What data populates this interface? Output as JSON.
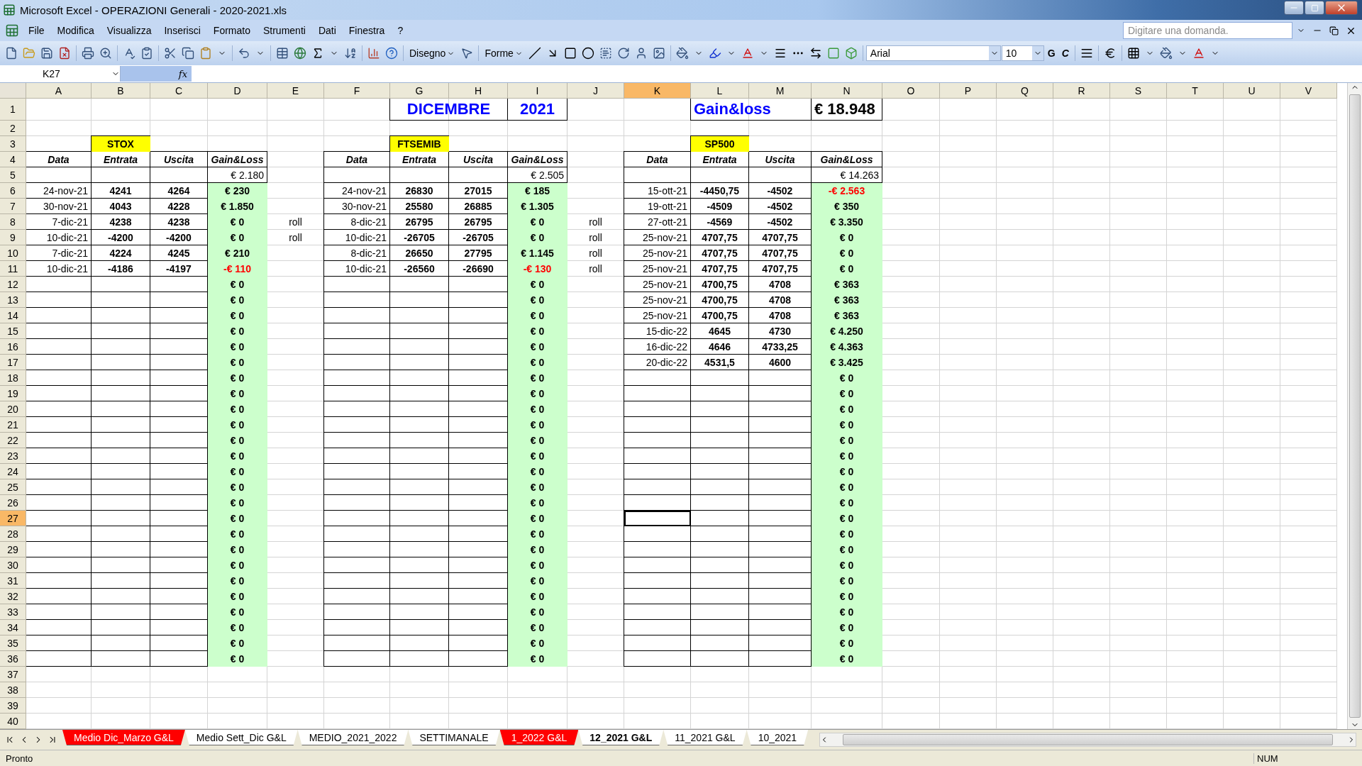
{
  "window": {
    "title": "Microsoft Excel - OPERAZIONI Generali - 2020-2021.xls"
  },
  "menu": [
    "File",
    "Modifica",
    "Visualizza",
    "Inserisci",
    "Formato",
    "Strumenti",
    "Dati",
    "Finestra",
    "?"
  ],
  "help_box": {
    "placeholder": "Digitare una domanda."
  },
  "drawing_toolbar": {
    "draw_menu": "Disegno",
    "shapes_menu": "Forme"
  },
  "format_toolbar": {
    "font": "Arial",
    "size": "10",
    "bold": "G",
    "italic": "C"
  },
  "formula_bar": {
    "name_box": "K27",
    "function_label": "fx"
  },
  "sheet": {
    "columns": [
      {
        "label": "A",
        "selected": false
      },
      {
        "label": "B",
        "selected": false
      },
      {
        "label": "C",
        "selected": false
      },
      {
        "label": "D",
        "selected": false
      },
      {
        "label": "E",
        "selected": false
      },
      {
        "label": "F",
        "selected": false
      },
      {
        "label": "G",
        "selected": false
      },
      {
        "label": "H",
        "selected": false
      },
      {
        "label": "I",
        "selected": false
      },
      {
        "label": "J",
        "selected": false
      },
      {
        "label": "K",
        "selected": true
      },
      {
        "label": "L",
        "selected": false
      },
      {
        "label": "M",
        "selected": false
      },
      {
        "label": "N",
        "selected": false
      },
      {
        "label": "O",
        "selected": false
      },
      {
        "label": "P",
        "selected": false
      },
      {
        "label": "Q",
        "selected": false
      },
      {
        "label": "R",
        "selected": false
      },
      {
        "label": "S",
        "selected": false
      },
      {
        "label": "T",
        "selected": false
      },
      {
        "label": "U",
        "selected": false
      },
      {
        "label": "V",
        "selected": false
      }
    ],
    "rows": [
      {
        "label": "1",
        "selected": false
      },
      {
        "label": "2",
        "selected": false
      },
      {
        "label": "3",
        "selected": false
      },
      {
        "label": "4",
        "selected": false
      },
      {
        "label": "5",
        "selected": false
      },
      {
        "label": "6",
        "selected": false
      },
      {
        "label": "7",
        "selected": false
      },
      {
        "label": "8",
        "selected": false
      },
      {
        "label": "9",
        "selected": false
      },
      {
        "label": "10",
        "selected": false
      },
      {
        "label": "11",
        "selected": false
      },
      {
        "label": "12",
        "selected": false
      },
      {
        "label": "13",
        "selected": false
      },
      {
        "label": "14",
        "selected": false
      },
      {
        "label": "15",
        "selected": false
      },
      {
        "label": "16",
        "selected": false
      },
      {
        "label": "17",
        "selected": false
      },
      {
        "label": "18",
        "selected": false
      },
      {
        "label": "19",
        "selected": false
      },
      {
        "label": "20",
        "selected": false
      },
      {
        "label": "21",
        "selected": false
      },
      {
        "label": "22",
        "selected": false
      },
      {
        "label": "23",
        "selected": false
      },
      {
        "label": "24",
        "selected": false
      },
      {
        "label": "25",
        "selected": false
      },
      {
        "label": "26",
        "selected": false
      },
      {
        "label": "27",
        "selected": true
      },
      {
        "label": "28",
        "selected": false
      },
      {
        "label": "29",
        "selected": false
      },
      {
        "label": "30",
        "selected": false
      },
      {
        "label": "31",
        "selected": false
      },
      {
        "label": "32",
        "selected": false
      },
      {
        "label": "33",
        "selected": false
      },
      {
        "label": "34",
        "selected": false
      },
      {
        "label": "35",
        "selected": false
      },
      {
        "label": "36",
        "selected": false
      },
      {
        "label": "37",
        "selected": false
      },
      {
        "label": "38",
        "selected": false
      },
      {
        "label": "39",
        "selected": false
      },
      {
        "label": "40",
        "selected": false
      }
    ],
    "title_cells": [
      "DICEMBRE",
      "2021",
      "Gain&loss",
      "€ 18.948"
    ],
    "tables": [
      {
        "label": "STOX",
        "headers": [
          "Data",
          "Entrata",
          "Uscita",
          "Gain&Loss"
        ],
        "total": "€ 2.180",
        "entries": [
          {
            "date": "24-nov-21",
            "entry": "4241",
            "exit": "4264",
            "result": "€ 230",
            "loss": false
          },
          {
            "date": "30-nov-21",
            "entry": "4043",
            "exit": "4228",
            "result": "€ 1.850",
            "loss": false
          },
          {
            "date": "7-dic-21",
            "entry": "4238",
            "exit": "4238",
            "result": "€ 0",
            "loss": false,
            "note": "roll"
          },
          {
            "date": "10-dic-21",
            "entry": "-4200",
            "exit": "-4200",
            "result": "€ 0",
            "loss": false,
            "note": "roll"
          },
          {
            "date": "7-dic-21",
            "entry": "4224",
            "exit": "4245",
            "result": "€ 210",
            "loss": false
          },
          {
            "date": "10-dic-21",
            "entry": "-4186",
            "exit": "-4197",
            "result": "-€ 110",
            "loss": true
          },
          {
            "result": "€ 0",
            "loss": false
          },
          {
            "result": "€ 0",
            "loss": false
          },
          {
            "result": "€ 0",
            "loss": false
          },
          {
            "result": "€ 0",
            "loss": false
          },
          {
            "result": "€ 0",
            "loss": false
          },
          {
            "result": "€ 0",
            "loss": false
          },
          {
            "result": "€ 0",
            "loss": false
          },
          {
            "result": "€ 0",
            "loss": false
          },
          {
            "result": "€ 0",
            "loss": false
          },
          {
            "result": "€ 0",
            "loss": false
          },
          {
            "result": "€ 0",
            "loss": false
          },
          {
            "result": "€ 0",
            "loss": false
          },
          {
            "result": "€ 0",
            "loss": false
          },
          {
            "result": "€ 0",
            "loss": false
          },
          {
            "result": "€ 0",
            "loss": false
          },
          {
            "result": "€ 0",
            "loss": false
          },
          {
            "result": "€ 0",
            "loss": false
          },
          {
            "result": "€ 0",
            "loss": false
          },
          {
            "result": "€ 0",
            "loss": false
          },
          {
            "result": "€ 0",
            "loss": false
          },
          {
            "result": "€ 0",
            "loss": false
          },
          {
            "result": "€ 0",
            "loss": false
          },
          {
            "result": "€ 0",
            "loss": false
          },
          {
            "result": "€ 0",
            "loss": false
          },
          {
            "result": "€ 0",
            "loss": false
          }
        ]
      },
      {
        "label": "FTSEMIB",
        "headers": [
          "Data",
          "Entrata",
          "Uscita",
          "Gain&Loss"
        ],
        "total": "€ 2.505",
        "entries": [
          {
            "date": "24-nov-21",
            "entry": "26830",
            "exit": "27015",
            "result": "€ 185",
            "loss": false
          },
          {
            "date": "30-nov-21",
            "entry": "25580",
            "exit": "26885",
            "result": "€ 1.305",
            "loss": false
          },
          {
            "date": "8-dic-21",
            "entry": "26795",
            "exit": "26795",
            "result": "€ 0",
            "loss": false,
            "note": "roll"
          },
          {
            "date": "10-dic-21",
            "entry": "-26705",
            "exit": "-26705",
            "result": "€ 0",
            "loss": false,
            "note": "roll"
          },
          {
            "date": "8-dic-21",
            "entry": "26650",
            "exit": "27795",
            "result": "€ 1.145",
            "loss": false,
            "note": "roll"
          },
          {
            "date": "10-dic-21",
            "entry": "-26560",
            "exit": "-26690",
            "result": "-€ 130",
            "loss": true,
            "note": "roll"
          },
          {
            "result": "€ 0",
            "loss": false
          },
          {
            "result": "€ 0",
            "loss": false
          },
          {
            "result": "€ 0",
            "loss": false
          },
          {
            "result": "€ 0",
            "loss": false
          },
          {
            "result": "€ 0",
            "loss": false
          },
          {
            "result": "€ 0",
            "loss": false
          },
          {
            "result": "€ 0",
            "loss": false
          },
          {
            "result": "€ 0",
            "loss": false
          },
          {
            "result": "€ 0",
            "loss": false
          },
          {
            "result": "€ 0",
            "loss": false
          },
          {
            "result": "€ 0",
            "loss": false
          },
          {
            "result": "€ 0",
            "loss": false
          },
          {
            "result": "€ 0",
            "loss": false
          },
          {
            "result": "€ 0",
            "loss": false
          },
          {
            "result": "€ 0",
            "loss": false
          },
          {
            "result": "€ 0",
            "loss": false
          },
          {
            "result": "€ 0",
            "loss": false
          },
          {
            "result": "€ 0",
            "loss": false
          },
          {
            "result": "€ 0",
            "loss": false
          },
          {
            "result": "€ 0",
            "loss": false
          },
          {
            "result": "€ 0",
            "loss": false
          },
          {
            "result": "€ 0",
            "loss": false
          },
          {
            "result": "€ 0",
            "loss": false
          },
          {
            "result": "€ 0",
            "loss": false
          },
          {
            "result": "€ 0",
            "loss": false
          }
        ]
      },
      {
        "label": "SP500",
        "headers": [
          "Data",
          "Entrata",
          "Uscita",
          "Gain&Loss"
        ],
        "total": "€ 14.263",
        "entries": [
          {
            "date": "15-ott-21",
            "entry": "-4450,75",
            "exit": "-4502",
            "result": "-€ 2.563",
            "loss": true
          },
          {
            "date": "19-ott-21",
            "entry": "-4509",
            "exit": "-4502",
            "result": "€ 350",
            "loss": false
          },
          {
            "date": "27-ott-21",
            "entry": "-4569",
            "exit": "-4502",
            "result": "€ 3.350",
            "loss": false
          },
          {
            "date": "25-nov-21",
            "entry": "4707,75",
            "exit": "4707,75",
            "result": "€ 0",
            "loss": false
          },
          {
            "date": "25-nov-21",
            "entry": "4707,75",
            "exit": "4707,75",
            "result": "€ 0",
            "loss": false
          },
          {
            "date": "25-nov-21",
            "entry": "4707,75",
            "exit": "4707,75",
            "result": "€ 0",
            "loss": false
          },
          {
            "date": "25-nov-21",
            "entry": "4700,75",
            "exit": "4708",
            "result": "€ 363",
            "loss": false
          },
          {
            "date": "25-nov-21",
            "entry": "4700,75",
            "exit": "4708",
            "result": "€ 363",
            "loss": false
          },
          {
            "date": "25-nov-21",
            "entry": "4700,75",
            "exit": "4708",
            "result": "€ 363",
            "loss": false
          },
          {
            "date": "15-dic-22",
            "entry": "4645",
            "exit": "4730",
            "result": "€ 4.250",
            "loss": false
          },
          {
            "date": "16-dic-22",
            "entry": "4646",
            "exit": "4733,25",
            "result": "€ 4.363",
            "loss": false
          },
          {
            "date": "20-dic-22",
            "entry": "4531,5",
            "exit": "4600",
            "result": "€ 3.425",
            "loss": false
          },
          {
            "result": "€ 0",
            "loss": false
          },
          {
            "result": "€ 0",
            "loss": false
          },
          {
            "result": "€ 0",
            "loss": false
          },
          {
            "result": "€ 0",
            "loss": false
          },
          {
            "result": "€ 0",
            "loss": false
          },
          {
            "result": "€ 0",
            "loss": false
          },
          {
            "result": "€ 0",
            "loss": false
          },
          {
            "result": "€ 0",
            "loss": false
          },
          {
            "result": "€ 0",
            "loss": false
          },
          {
            "result": "€ 0",
            "loss": false
          },
          {
            "result": "€ 0",
            "loss": false
          },
          {
            "result": "€ 0",
            "loss": false
          },
          {
            "result": "€ 0",
            "loss": false
          },
          {
            "result": "€ 0",
            "loss": false
          },
          {
            "result": "€ 0",
            "loss": false
          },
          {
            "result": "€ 0",
            "loss": false
          },
          {
            "result": "€ 0",
            "loss": false
          },
          {
            "result": "€ 0",
            "loss": false
          },
          {
            "result": "€ 0",
            "loss": false
          }
        ]
      }
    ]
  },
  "sheet_tabs": [
    {
      "label": "Medio Dic_Marzo G&L",
      "selected": false,
      "color": "#ff0000"
    },
    {
      "label": "Medio Sett_Dic G&L",
      "selected": false,
      "color": "#ffffff"
    },
    {
      "label": "MEDIO_2021_2022",
      "selected": false,
      "color": "#ffffff"
    },
    {
      "label": "SETTIMANALE",
      "selected": false,
      "color": "#ffffff"
    },
    {
      "label": "1_2022 G&L",
      "selected": false,
      "color": "#ff0000"
    },
    {
      "label": "12_2021 G&L",
      "selected": true,
      "color": "#ffffff"
    },
    {
      "label": "11_2021 G&L",
      "selected": false,
      "color": "#ffffff"
    },
    {
      "label": "10_2021",
      "selected": false,
      "color": "#ffffff"
    }
  ],
  "status_bar": {
    "message": "Pronto",
    "indicator": "NUM"
  }
}
